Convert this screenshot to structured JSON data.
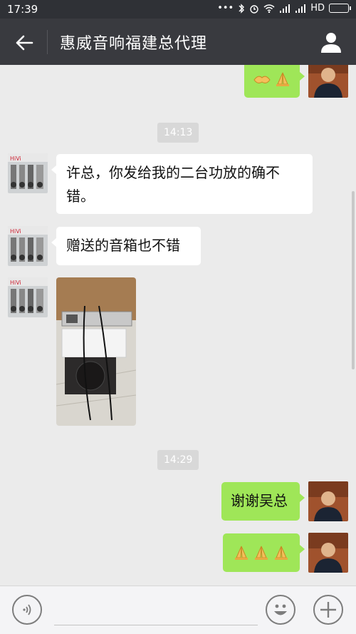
{
  "status_bar": {
    "time": "17:39",
    "indicators": [
      "bluetooth-icon",
      "alarm-icon",
      "wifi-icon",
      "signal-icon",
      "signal-icon"
    ],
    "network": "HD"
  },
  "header": {
    "title": "惠威音响福建总代理",
    "back_icon": "arrow-left-icon",
    "profile_icon": "user-icon"
  },
  "messages": {
    "ts1": "14:13",
    "in1": "许总，你发给我的二台功放的确不错。",
    "in2": "赠送的音箱也不错",
    "ts2": "14:29",
    "out1": "谢谢吴总"
  },
  "colors": {
    "header_bg": "#393a3f",
    "status_bg": "#2f3136",
    "chat_bg": "#ebebeb",
    "outgoing_bubble": "#9fe658",
    "incoming_bubble": "#ffffff"
  },
  "input_bar": {
    "voice_icon": "voice-icon",
    "emoji_icon": "smiley-icon",
    "plus_icon": "plus-icon"
  }
}
